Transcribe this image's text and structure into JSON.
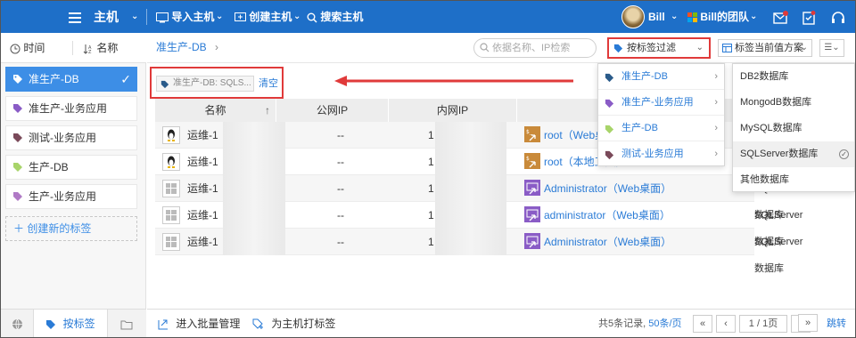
{
  "topbar": {
    "menu_title": "主机",
    "import": "导入主机",
    "create": "创建主机",
    "search": "搜索主机",
    "user": "Bill",
    "team": "Bill的团队"
  },
  "sidebar": {
    "sort_time": "时间",
    "sort_name": "名称",
    "tags": [
      {
        "label": "准生产-DB",
        "color": "#2a5b8a"
      },
      {
        "label": "准生产-业务应用",
        "color": "#8a5cc6"
      },
      {
        "label": "测试-业务应用",
        "color": "#7a4a5a"
      },
      {
        "label": "生产-DB",
        "color": "#a8d46a"
      },
      {
        "label": "生产-业务应用",
        "color": "#b07ac6"
      }
    ],
    "create_tag": "创建新的标签"
  },
  "main": {
    "breadcrumb": "准生产-DB",
    "search_placeholder": "依据名称、IP检索",
    "filter_label": "按标签过滤",
    "scheme_label": "标签当前值方案",
    "chip_text": "准生产-DB: SQLS...",
    "clear": "清空"
  },
  "table": {
    "headers": [
      "名称",
      "公网IP",
      "内网IP",
      "",
      ""
    ],
    "rows": [
      {
        "os": "linux",
        "name": "运维-1",
        "public_ip": "--",
        "private_ip": "1",
        "account": "root（Web桌面）",
        "db": ""
      },
      {
        "os": "linux",
        "name": "运维-1",
        "public_ip": "--",
        "private_ip": "1",
        "account": "root（本地工具）",
        "db": ""
      },
      {
        "os": "windows",
        "name": "运维-1",
        "public_ip": "--",
        "private_ip": "1",
        "account": "Administrator（Web桌面）",
        "db": "SQLServer数据库"
      },
      {
        "os": "windows",
        "name": "运维-1",
        "public_ip": "--",
        "private_ip": "1",
        "account": "administrator（Web桌面）",
        "db": "SQLServer数据库"
      },
      {
        "os": "windows",
        "name": "运维-1",
        "public_ip": "--",
        "private_ip": "1",
        "account": "Administrator（Web桌面）",
        "db": "SQLServer数据库"
      }
    ]
  },
  "tag_menu": [
    {
      "label": "准生产-DB",
      "color": "#2a5b8a"
    },
    {
      "label": "准生产-业务应用",
      "color": "#8a5cc6"
    },
    {
      "label": "生产-DB",
      "color": "#a8d46a"
    },
    {
      "label": "测试-业务应用",
      "color": "#7a4a5a"
    }
  ],
  "value_menu": [
    {
      "label": "DB2数据库",
      "selected": false
    },
    {
      "label": "MongodB数据库",
      "selected": false
    },
    {
      "label": "MySQL数据库",
      "selected": false
    },
    {
      "label": "SQLServer数据库",
      "selected": true
    },
    {
      "label": "其他数据库",
      "selected": false
    }
  ],
  "bottom": {
    "tab_tags": "按标签",
    "batch": "进入批量管理",
    "tag_host": "为主机打标签",
    "summary_prefix": "共5条记录,",
    "per_page": "50条/页",
    "page_text": "1 / 1页",
    "jump": "跳转"
  }
}
